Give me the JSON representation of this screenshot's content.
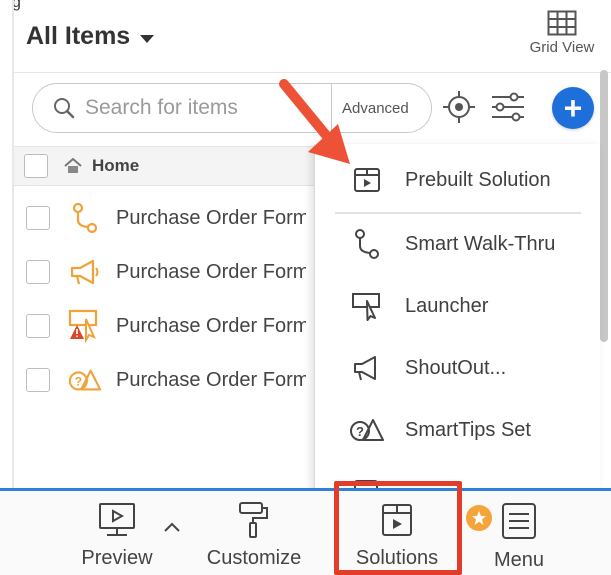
{
  "header": {
    "title": "All Items",
    "top_cut_text": "g",
    "grid_view_label": "Grid View"
  },
  "search": {
    "placeholder": "Search for items",
    "advanced_label": "Advanced"
  },
  "list": {
    "home_label": "Home",
    "rows": [
      {
        "label": "Purchase Order Form",
        "icon": "smart-walk-thru-icon"
      },
      {
        "label": "Purchase Order Form",
        "icon": "shoutout-icon"
      },
      {
        "label": "Purchase Order Form",
        "icon": "launcher-warning-icon"
      },
      {
        "label": "Purchase Order Form",
        "icon": "smarttips-icon"
      }
    ]
  },
  "dropdown": {
    "items": [
      {
        "label": "Prebuilt Solution",
        "icon": "prebuilt-solution-icon"
      },
      {
        "label": "Smart Walk-Thru",
        "icon": "smart-walk-thru-icon"
      },
      {
        "label": "Launcher",
        "icon": "launcher-icon"
      },
      {
        "label": "ShoutOut...",
        "icon": "shoutout-icon"
      },
      {
        "label": "SmartTips Set",
        "icon": "smarttips-icon"
      }
    ]
  },
  "bottombar": {
    "preview": "Preview",
    "customize": "Customize",
    "solutions": "Solutions",
    "menu": "Menu"
  },
  "colors": {
    "accent": "#1e6fd9",
    "highlight": "#e23d2b",
    "icon_orange": "#f5a43a",
    "bottom_border": "#2f80d6"
  }
}
